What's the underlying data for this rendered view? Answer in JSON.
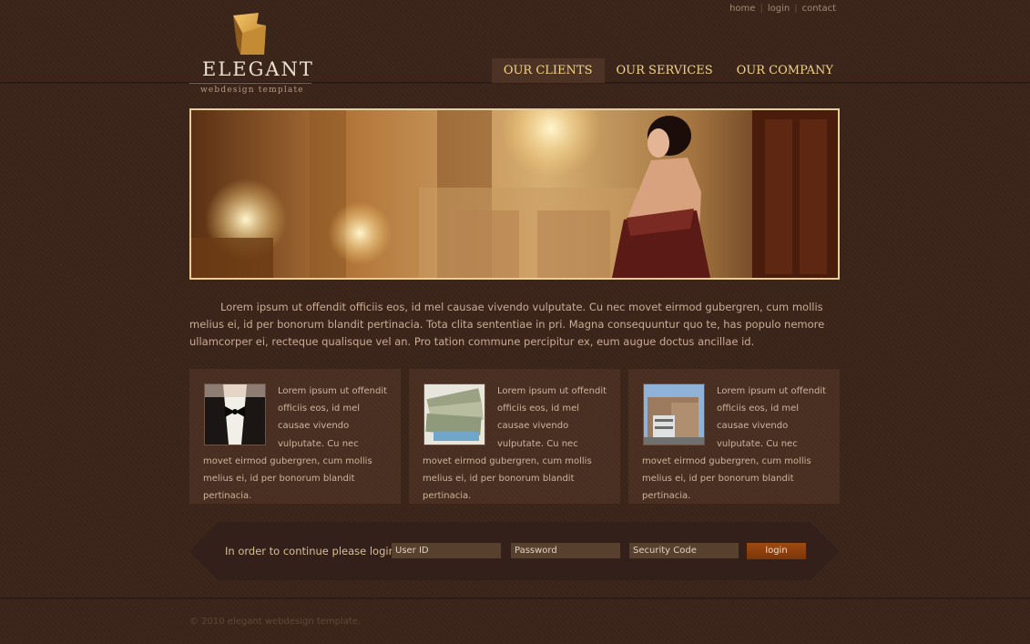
{
  "top_links": {
    "home": "home",
    "login": "login",
    "contact": "contact",
    "separator": "|"
  },
  "logo": {
    "title": "ELEGANT",
    "subtitle": "webdesign template"
  },
  "nav": {
    "clients": "OUR CLIENTS",
    "services": "OUR SERVICES",
    "company": "OUR COMPANY"
  },
  "intro": "Lorem ipsum ut offendit officiis eos, id mel causae vivendo vulputate. Cu nec movet eirmod gubergren, cum mollis melius ei, id per bonorum blandit pertinacia. Tota clita sententiae in pri. Magna consequuntur quo te, has populo nemore ullamcorper ei, recteque qualisque vel an. Pro tation commune percipitur ex, eum augue doctus ancillae id.",
  "boxes": [
    {
      "text": "Lorem ipsum ut offendit officiis eos, id mel causae vivendo vulputate. Cu nec movet eirmod gubergren, cum mollis melius ei, id per bonorum blandit pertinacia."
    },
    {
      "text": "Lorem ipsum ut offendit officiis eos, id mel causae vivendo vulputate. Cu nec movet eirmod gubergren, cum mollis melius ei, id per bonorum blandit pertinacia."
    },
    {
      "text": "Lorem ipsum ut offendit officiis eos, id mel causae vivendo vulputate. Cu nec movet eirmod gubergren, cum mollis melius ei, id per bonorum blandit pertinacia."
    }
  ],
  "login": {
    "label": "In order to continue please login:",
    "user_id": "User ID",
    "password": "Password",
    "security_code": "Security Code",
    "button": "login"
  },
  "footer": "© 2010 elegant webdesign template.",
  "colors": {
    "background": "#3b2419",
    "nav_text": "#f2d488",
    "accent_button": "#9e4a12",
    "banner_border": "#e8cf9a"
  }
}
